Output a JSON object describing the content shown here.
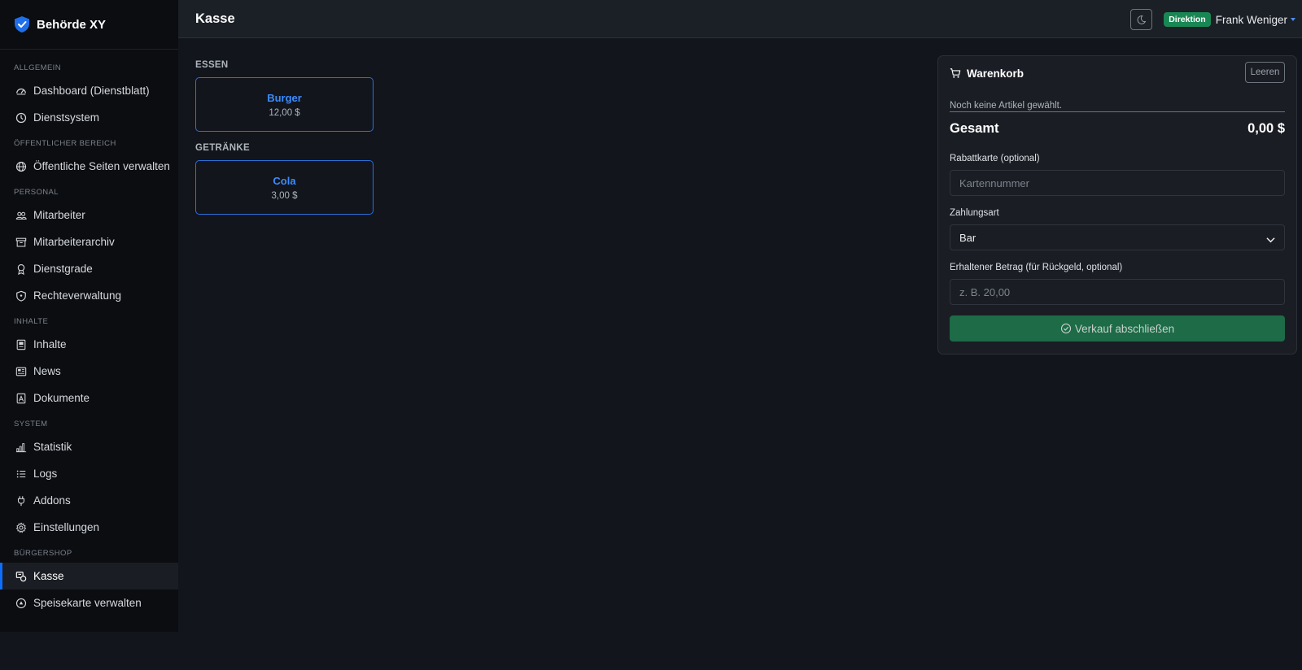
{
  "app": {
    "brand": "Behörde XY",
    "page_title": "Kasse"
  },
  "header": {
    "role_badge": "Direktion",
    "user_name": "Frank Weniger",
    "theme_toggle_icon": "moon-icon"
  },
  "sidebar": {
    "sections": [
      {
        "label": "Allgemein",
        "items": [
          {
            "label": "Dashboard (Dienstblatt)",
            "icon": "speedometer-icon"
          },
          {
            "label": "Dienstsystem",
            "icon": "clock-icon"
          }
        ]
      },
      {
        "label": "Öffentlicher Bereich",
        "items": [
          {
            "label": "Öffentliche Seiten verwalten",
            "icon": "globe-icon"
          }
        ]
      },
      {
        "label": "Personal",
        "items": [
          {
            "label": "Mitarbeiter",
            "icon": "people-icon"
          },
          {
            "label": "Mitarbeiterarchiv",
            "icon": "archive-icon"
          },
          {
            "label": "Dienstgrade",
            "icon": "award-icon"
          },
          {
            "label": "Rechteverwaltung",
            "icon": "shield-icon"
          }
        ]
      },
      {
        "label": "Inhalte",
        "items": [
          {
            "label": "Inhalte",
            "icon": "file-text-icon"
          },
          {
            "label": "News",
            "icon": "newspaper-icon"
          },
          {
            "label": "Dokumente",
            "icon": "file-pdf-icon"
          }
        ]
      },
      {
        "label": "System",
        "items": [
          {
            "label": "Statistik",
            "icon": "bar-chart-icon"
          },
          {
            "label": "Logs",
            "icon": "list-icon"
          },
          {
            "label": "Addons",
            "icon": "plug-icon"
          },
          {
            "label": "Einstellungen",
            "icon": "gear-icon"
          }
        ]
      },
      {
        "label": "Bürgershop",
        "items": [
          {
            "label": "Kasse",
            "icon": "cash-register-icon",
            "active": true
          },
          {
            "label": "Speisekarte verwalten",
            "icon": "menu-card-icon"
          }
        ]
      }
    ]
  },
  "products": {
    "categories": [
      {
        "label": "Essen",
        "items": [
          {
            "name": "Burger",
            "price": "12,00 $"
          }
        ]
      },
      {
        "label": "Getränke",
        "items": [
          {
            "name": "Cola",
            "price": "3,00 $"
          }
        ]
      }
    ]
  },
  "cart": {
    "title": "Warenkorb",
    "clear_label": "Leeren",
    "empty_note": "Noch keine Artikel gewählt.",
    "total_label": "Gesamt",
    "total_value": "0,00 $",
    "discount_label": "Rabattkarte (optional)",
    "discount_placeholder": "Kartennummer",
    "payment_label": "Zahlungsart",
    "payment_value": "Bar",
    "received_label": "Erhaltener Betrag (für Rückgeld, optional)",
    "received_placeholder": "z. B. 20,00",
    "submit_label": "Verkauf abschließen"
  },
  "colors": {
    "accent": "#0d6efd",
    "success": "#198754",
    "submit": "#1d6b47"
  }
}
